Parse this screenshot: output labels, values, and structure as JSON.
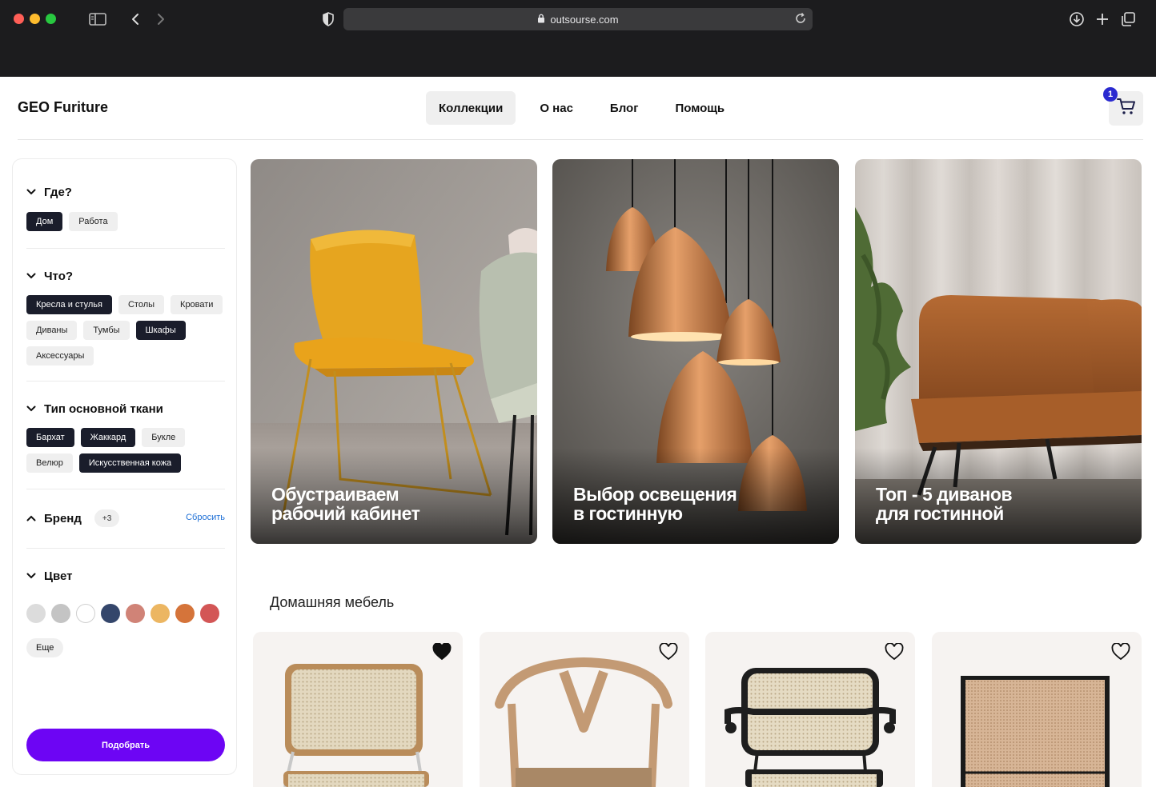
{
  "browser": {
    "url": "outsourse.com"
  },
  "header": {
    "logo": "GEO Furiture",
    "nav": [
      "Коллекции",
      "О нас",
      "Блог",
      "Помощь"
    ],
    "cart_count": "1"
  },
  "filters": {
    "where": {
      "title": "Где?",
      "options": [
        {
          "label": "Дом",
          "selected": true
        },
        {
          "label": "Работа",
          "selected": false
        }
      ]
    },
    "what": {
      "title": "Что?",
      "options": [
        {
          "label": "Кресла и стулья",
          "selected": true
        },
        {
          "label": "Столы",
          "selected": false
        },
        {
          "label": "Кровати",
          "selected": false
        },
        {
          "label": "Диваны",
          "selected": false
        },
        {
          "label": "Тумбы",
          "selected": false
        },
        {
          "label": "Шкафы",
          "selected": true
        },
        {
          "label": "Аксессуары",
          "selected": false
        }
      ]
    },
    "fabric": {
      "title": "Тип основной ткани",
      "options": [
        {
          "label": "Бархат",
          "selected": true
        },
        {
          "label": "Жаккард",
          "selected": true
        },
        {
          "label": "Букле",
          "selected": false
        },
        {
          "label": "Велюр",
          "selected": false
        },
        {
          "label": "Искусственная кожа",
          "selected": true
        }
      ]
    },
    "brand": {
      "title": "Бренд",
      "count": "+3",
      "reset": "Сбросить"
    },
    "color": {
      "title": "Цвет",
      "swatches": [
        "#dcdcdc",
        "#c4c4c4",
        "#ffffff",
        "#34466b",
        "#d08377",
        "#ecb662",
        "#d5743a",
        "#d35656"
      ],
      "more": "Еще"
    },
    "submit": "Подобрать"
  },
  "feature_cards": [
    {
      "title": "Обустраиваем\nрабочий кабинет"
    },
    {
      "title": "Выбор освещения\nв гостинную"
    },
    {
      "title": "Топ - 5 диванов\nдля гостинной"
    }
  ],
  "section_title": "Домашняя мебель",
  "products": [
    {
      "favorited": true
    },
    {
      "favorited": false
    },
    {
      "favorited": false
    },
    {
      "favorited": false
    }
  ]
}
